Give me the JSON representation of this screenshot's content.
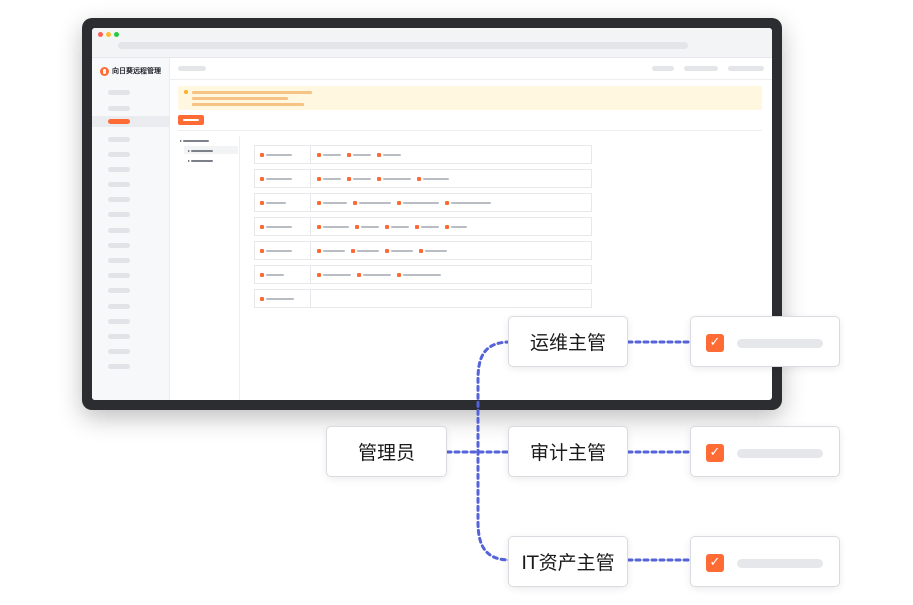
{
  "app": {
    "brand_name": "向日葵远程管理"
  },
  "diagram": {
    "root_label": "管理员",
    "roles": [
      {
        "label": "运维主管"
      },
      {
        "label": "审计主管"
      },
      {
        "label": "IT资产主管"
      }
    ]
  },
  "colors": {
    "accent": "#ff6b35",
    "connector": "#5563d9",
    "notice_bg": "#fff7e0",
    "frame": "#2b2d31"
  },
  "icons": {
    "check": "✓"
  }
}
